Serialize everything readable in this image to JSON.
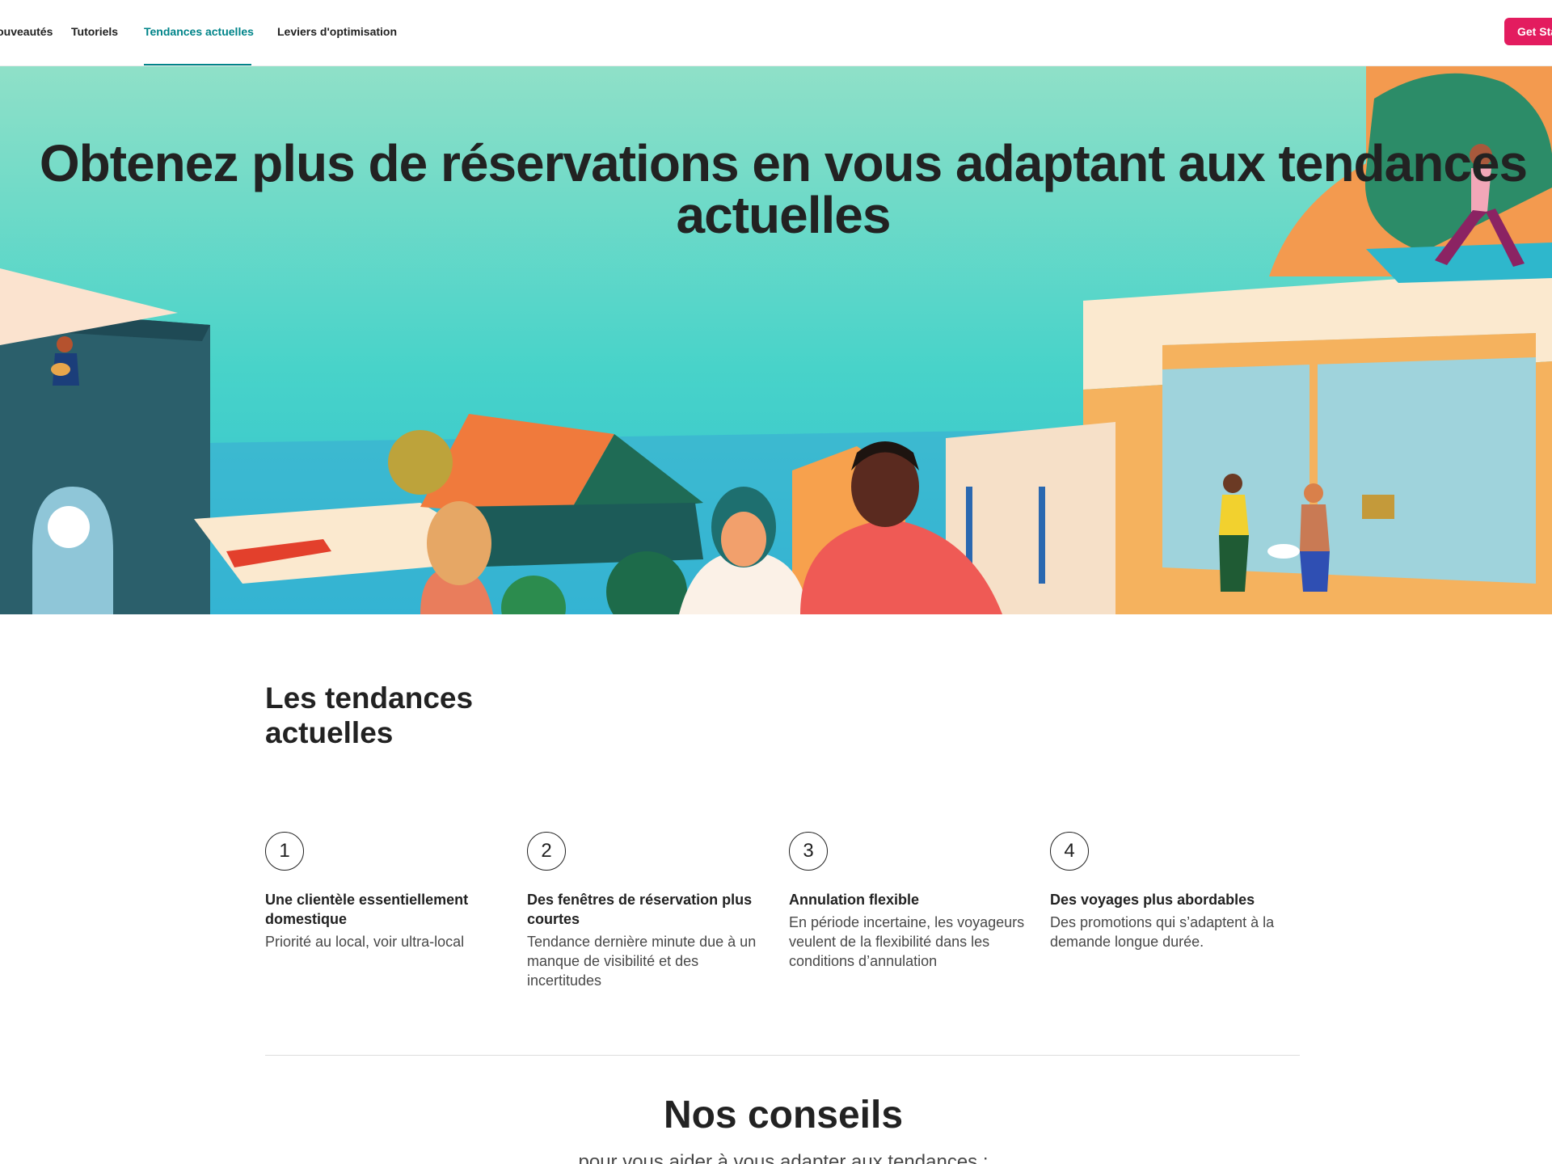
{
  "nav": {
    "items": [
      "Nouveautés",
      "Tutoriels",
      "Tendances actuelles",
      "Leviers d'optimisation"
    ],
    "active": "Tendances actuelles",
    "cta_label": "Get Started"
  },
  "hero": {
    "title_line1": "Obtenez plus de réservations en vous adaptant aux tendances",
    "title_line2": "actuelles"
  },
  "trends": {
    "heading_line1": "Les tendances",
    "heading_line2": "actuelles",
    "items": [
      {
        "number": "1",
        "title": "Une clientèle essentiellement domestique",
        "description": "Priorité au local, voir ultra-local"
      },
      {
        "number": "2",
        "title": "Des fenêtres de réservation plus courtes",
        "description": "Tendance dernière minute due à un manque de visibilité et des incertitudes"
      },
      {
        "number": "3",
        "title": "Annulation flexible",
        "description": "En période incertaine, les voyageurs veulent de la flexibilité dans les conditions d’annulation"
      },
      {
        "number": "4",
        "title": "Des voyages plus abordables",
        "description": "Des promotions qui s’adaptent à la demande longue durée."
      }
    ]
  },
  "tips": {
    "heading": "Nos conseils",
    "subheading": "pour vous aider à vous adapter aux tendances :"
  },
  "colors": {
    "accent": "#008489",
    "cta": "#e31c5f",
    "hero_sky": "#5ed6c8"
  }
}
